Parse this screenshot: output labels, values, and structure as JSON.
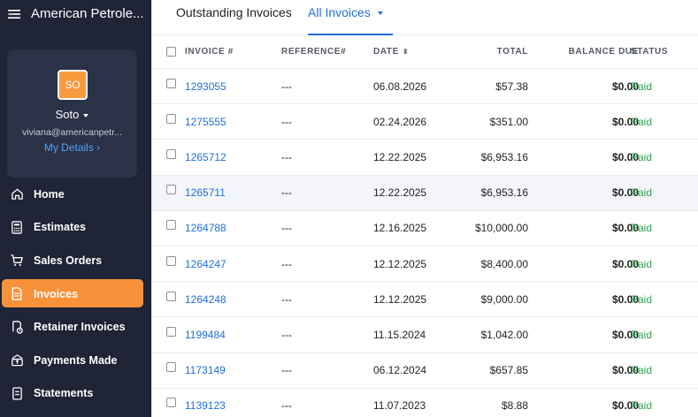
{
  "app": {
    "org_name": "American Petrole...",
    "icons": {
      "menu": "hamburger-icon",
      "home": "home-icon",
      "estimates": "calculator-icon",
      "sales_orders": "cart-icon",
      "invoices": "invoice-icon",
      "retainer": "retainer-icon",
      "payments": "payment-icon",
      "statements": "statement-icon"
    },
    "colors": {
      "sidebar_bg": "#1f2436",
      "accent": "#f7923a",
      "link": "#1f6fd8",
      "paid": "#2ea44f"
    }
  },
  "profile": {
    "initials": "SO",
    "name": "Soto",
    "email": "viviana@americanpetr...",
    "my_details": "My Details ›"
  },
  "nav": [
    {
      "label": "Home"
    },
    {
      "label": "Estimates"
    },
    {
      "label": "Sales Orders"
    },
    {
      "label": "Invoices",
      "active": true
    },
    {
      "label": "Retainer Invoices"
    },
    {
      "label": "Payments Made"
    },
    {
      "label": "Statements"
    }
  ],
  "tabs": {
    "outstanding": "Outstanding Invoices",
    "all": "All Invoices"
  },
  "table": {
    "headers": {
      "invoice": "INVOICE #",
      "reference": "REFERENCE#",
      "date": "DATE",
      "total": "TOTAL",
      "balance": "BALANCE DUE",
      "status": "STATUS"
    },
    "rows": [
      {
        "invoice": "1293055",
        "reference": "---",
        "date": "06.08.2026",
        "total": "$57.38",
        "balance": "$0.00",
        "status": "Paid"
      },
      {
        "invoice": "1275555",
        "reference": "---",
        "date": "02.24.2026",
        "total": "$351.00",
        "balance": "$0.00",
        "status": "Paid"
      },
      {
        "invoice": "1265712",
        "reference": "---",
        "date": "12.22.2025",
        "total": "$6,953.16",
        "balance": "$0.00",
        "status": "Paid"
      },
      {
        "invoice": "1265711",
        "reference": "---",
        "date": "12.22.2025",
        "total": "$6,953.16",
        "balance": "$0.00",
        "status": "Paid",
        "highlight": true
      },
      {
        "invoice": "1264788",
        "reference": "---",
        "date": "12.16.2025",
        "total": "$10,000.00",
        "balance": "$0.00",
        "status": "Paid"
      },
      {
        "invoice": "1264247",
        "reference": "---",
        "date": "12.12.2025",
        "total": "$8,400.00",
        "balance": "$0.00",
        "status": "Paid"
      },
      {
        "invoice": "1264248",
        "reference": "---",
        "date": "12.12.2025",
        "total": "$9,000.00",
        "balance": "$0.00",
        "status": "Paid"
      },
      {
        "invoice": "1199484",
        "reference": "---",
        "date": "11.15.2024",
        "total": "$1,042.00",
        "balance": "$0.00",
        "status": "Paid"
      },
      {
        "invoice": "1173149",
        "reference": "---",
        "date": "06.12.2024",
        "total": "$657.85",
        "balance": "$0.00",
        "status": "Paid"
      },
      {
        "invoice": "1139123",
        "reference": "---",
        "date": "11.07.2023",
        "total": "$8.88",
        "balance": "$0.00",
        "status": "Paid"
      }
    ]
  }
}
